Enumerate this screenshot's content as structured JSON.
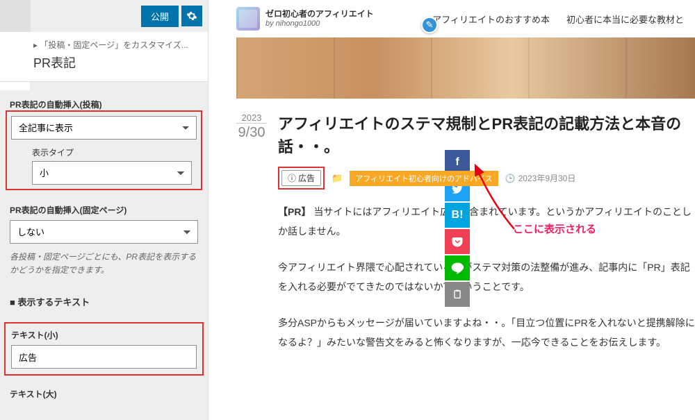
{
  "toolbar": {
    "publish": "公開",
    "gear_icon": "gear"
  },
  "breadcrumb": "「投稿・固定ページ」をカスタマイズ...",
  "panel_title": "PR表記",
  "sec1": {
    "label": "PR表記の自動挿入(投稿)",
    "select_value": "全記事に表示",
    "type_label": "表示タイプ",
    "type_value": "小"
  },
  "sec2": {
    "label": "PR表記の自動挿入(固定ページ)",
    "select_value": "しない",
    "desc": "各投稿・固定ページごとにも、PR表記を表示するかどうかを指定できます。"
  },
  "sec3": {
    "heading": "■ 表示するテキスト"
  },
  "text_small": {
    "label": "テキスト(小)",
    "value": "広告"
  },
  "text_large": {
    "label": "テキスト(大)"
  },
  "site": {
    "name_line1": "ゼロ初心者のアフィリエイト",
    "name_line2": "by nihongo1000",
    "nav1": "アフィリエイトのおすすめ本",
    "nav2": "初心者に本当に必要な教材と"
  },
  "post": {
    "year": "2023",
    "md": "9/30",
    "title": "アフィリエイトのステマ規制とPR表記の記載方法と本音の話・・。",
    "pr_badge": "広告",
    "category": "アフィリエイト初心者向けのアドバイス",
    "date": "2023年9月30日",
    "p1_label": "【PR】",
    "p1": "当サイトにはアフィリエイト広告が含まれています。というかアフィリエイトのことしか話しません。",
    "p2": "今アフィリエイト界隈で心配されているのがステマ対策の法整備が進み、記事内に「PR」表記を入れる必要がでてきたのではないか？ということです。",
    "p3": "多分ASPからもメッセージが届いていますよね・・。「目立つ位置にPRを入れないと提携解除になるよ？」みたいな警告文をみると怖くなりますが、一応今できることをお伝えします。"
  },
  "annotation": "ここに表示される"
}
